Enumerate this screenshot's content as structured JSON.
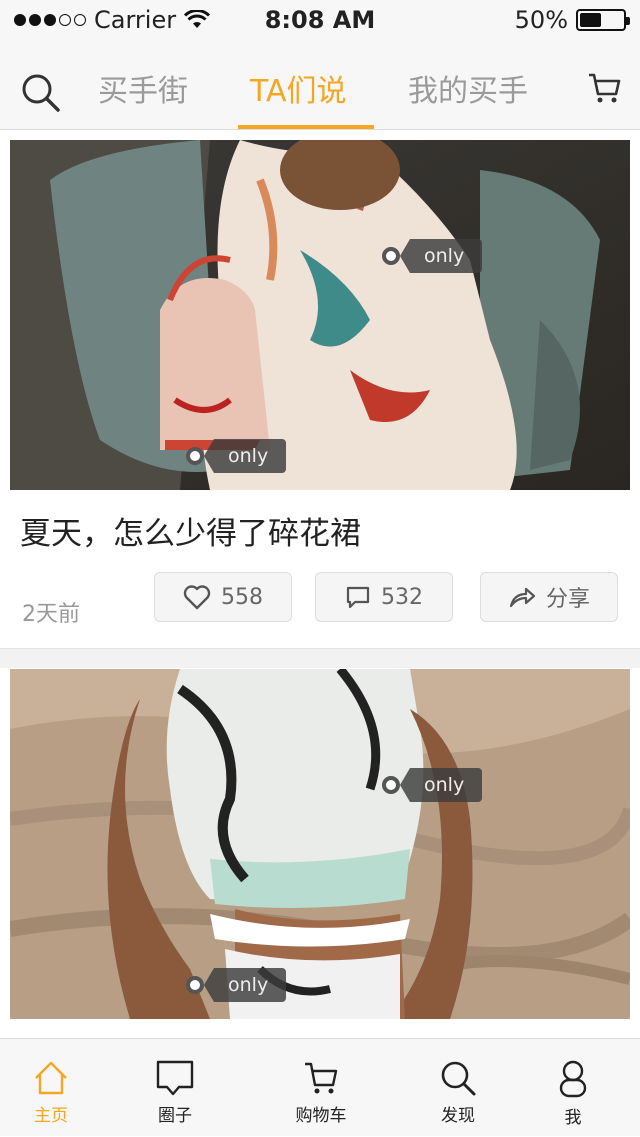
{
  "status_bar": {
    "carrier": "Carrier",
    "time": "8:08 AM",
    "battery": "50%",
    "battery_level": 0.5
  },
  "nav": {
    "tabs": [
      {
        "label": "买手街",
        "active": false
      },
      {
        "label": "TA们说",
        "active": true
      },
      {
        "label": "我的买手",
        "active": false
      }
    ],
    "accent_color": "#f5a623"
  },
  "posts": [
    {
      "tags": [
        "only",
        "only"
      ],
      "title": "夏天，怎么少得了碎花裙",
      "time": "2天前",
      "likes": "558",
      "comments": "532",
      "share_label": "分享"
    },
    {
      "tags": [
        "only",
        "only"
      ]
    }
  ],
  "tabbar": {
    "items": [
      {
        "label": "主页",
        "active": true
      },
      {
        "label": "圈子",
        "active": false
      },
      {
        "label": "购物车",
        "active": false
      },
      {
        "label": "发现",
        "active": false
      },
      {
        "label": "我",
        "active": false
      }
    ]
  }
}
